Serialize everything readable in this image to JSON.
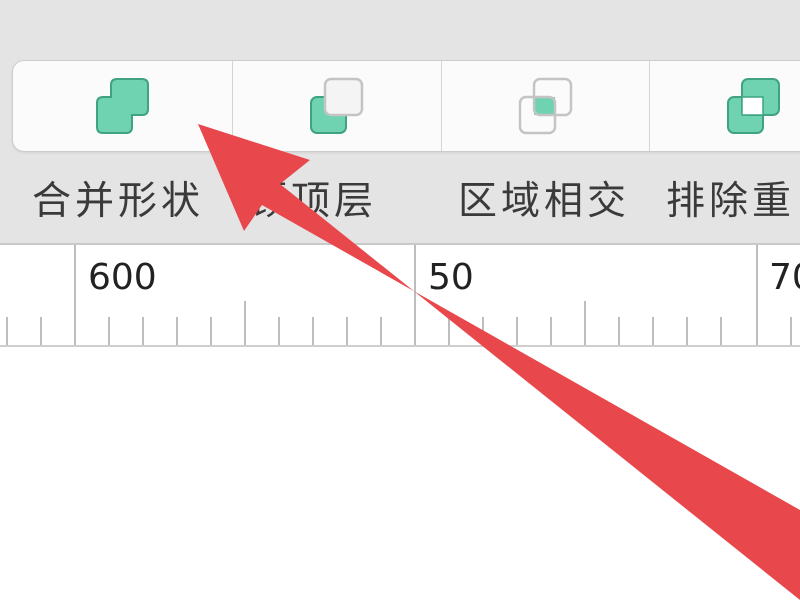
{
  "toolbar": {
    "buttons": [
      {
        "label": "合并形状",
        "icon": "merge-shapes-icon"
      },
      {
        "label": "顾顶层",
        "icon": "front-shape-icon"
      },
      {
        "label": "区域相交",
        "icon": "intersect-shapes-icon"
      },
      {
        "label": "排除重",
        "icon": "exclude-overlap-icon"
      }
    ]
  },
  "ruler": {
    "labels": [
      "600",
      "50",
      "70"
    ]
  },
  "colors": {
    "shape_fill": "#6fd3b1",
    "shape_stroke": "#3fa383",
    "shape_outline": "#c4c4c4",
    "annotation_arrow": "#e8474b"
  }
}
